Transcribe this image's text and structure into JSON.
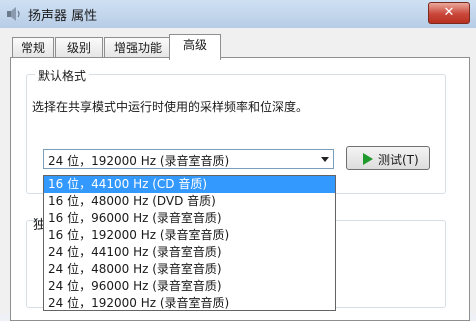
{
  "window": {
    "title": "扬声器 属性",
    "close_glyph": "✕"
  },
  "tabs": [
    {
      "label": "常规",
      "active": false
    },
    {
      "label": "级别",
      "active": false
    },
    {
      "label": "增强功能",
      "active": false
    },
    {
      "label": "高级",
      "active": true
    }
  ],
  "default_format": {
    "legend": "默认格式",
    "description": "选择在共享模式中运行时使用的采样频率和位深度。",
    "selected": "24 位，192000 Hz (录音室音质)",
    "test_button_label": "测试(T)"
  },
  "dropdown_options": [
    "16 位，44100 Hz (CD 音质)",
    "16 位，48000 Hz (DVD 音质)",
    "16 位，96000 Hz (录音室音质)",
    "16 位，192000 Hz (录音室音质)",
    "24 位，44100 Hz (录音室音质)",
    "24 位，48000 Hz (录音室音质)",
    "24 位，96000 Hz (录音室音质)",
    "24 位，192000 Hz (录音室音质)"
  ],
  "highlighted_option_index": 0,
  "second_group_legend_fragment": "独",
  "colors": {
    "highlight": "#3399ff",
    "play_icon": "#1f9a2c",
    "close_button": "#c9473a"
  }
}
